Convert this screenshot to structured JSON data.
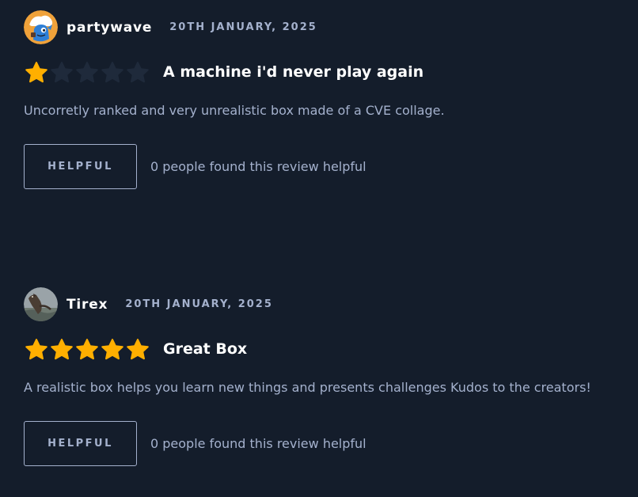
{
  "colors": {
    "background": "#141d2b",
    "star_filled": "#ffaf00",
    "star_empty": "#1f2a3b",
    "muted_text": "#a4b1cd",
    "primary_text": "#ffffff"
  },
  "reviews": [
    {
      "username": "partywave",
      "date": "20TH JANUARY, 2025",
      "avatar_icon": "cartoon-dragon-avatar-icon",
      "rating": 1,
      "rating_max": 5,
      "title": "A machine i'd never play again",
      "body": "Uncorretly ranked and very unrealistic box made of a CVE collage.",
      "helpful_label": "HELPFUL",
      "helpful_text": "0 people found this review helpful"
    },
    {
      "username": "Tirex",
      "date": "20TH JANUARY, 2025",
      "avatar_icon": "dinosaur-photo-avatar-icon",
      "rating": 5,
      "rating_max": 5,
      "title": "Great Box",
      "body": "A realistic box helps you learn new things and presents challenges Kudos to the creators!",
      "helpful_label": "HELPFUL",
      "helpful_text": "0 people found this review helpful"
    }
  ]
}
